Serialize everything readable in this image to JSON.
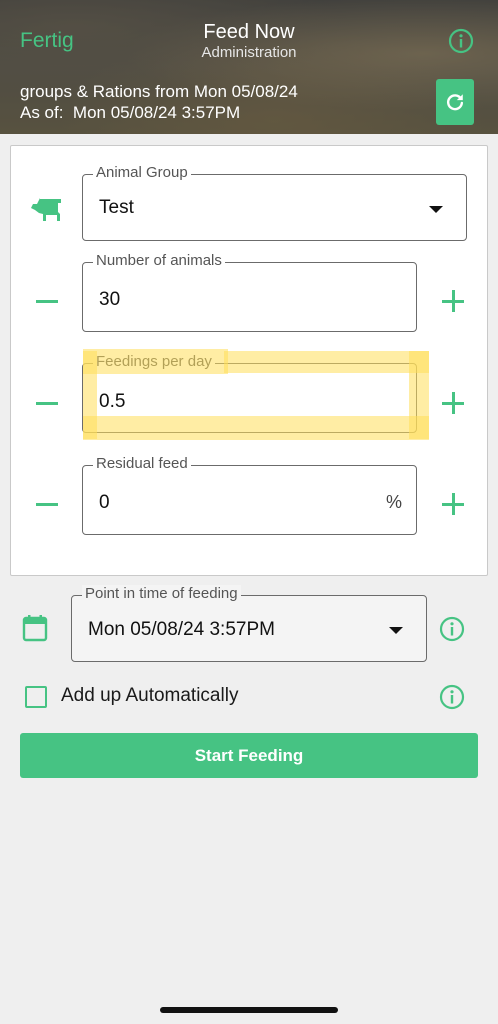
{
  "header": {
    "back_label": "Fertig",
    "title": "Feed Now",
    "subtitle": "Administration",
    "rations_text": "groups & Rations from Mon 05/08/24",
    "as_of_text": "As of:  Mon 05/08/24 3:57PM"
  },
  "form": {
    "animal_group": {
      "label": "Animal Group",
      "value": "Test"
    },
    "number_of_animals": {
      "label": "Number of animals",
      "value": "30"
    },
    "feedings_per_day": {
      "label": "Feedings per day",
      "value": "0.5"
    },
    "residual_feed": {
      "label": "Residual feed",
      "value": "0",
      "unit": "%"
    }
  },
  "feeding_time": {
    "label": "Point in time of feeding",
    "value": "Mon 05/08/24 3:57PM"
  },
  "add_up": {
    "label": "Add up Automatically",
    "checked": false
  },
  "start_button": {
    "label": "Start Feeding"
  },
  "colors": {
    "accent": "#46c383",
    "highlight": "#ffde5a",
    "background": "#efefef"
  },
  "icons": [
    "info-icon",
    "refresh-icon",
    "cow-icon",
    "calendar-icon",
    "minus-icon",
    "plus-icon",
    "dropdown-caret-icon"
  ]
}
